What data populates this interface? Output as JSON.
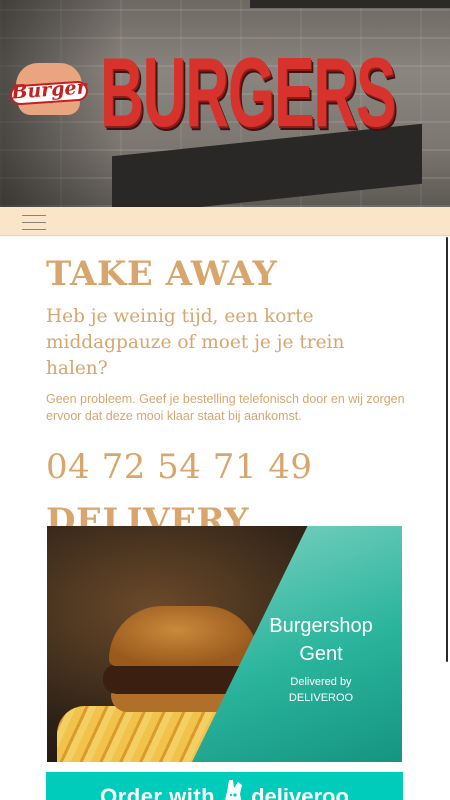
{
  "hero": {
    "sign_text": "BURGERS"
  },
  "logo": {
    "text": "Burger"
  },
  "nav": {
    "menu_icon": "hamburger-menu-icon"
  },
  "takeaway": {
    "heading": "TAKE AWAY",
    "lead": "Heb je weinig tijd, een korte middagpauze of moet je je trein halen?",
    "body": "Geen probleem. Geef je bestelling telefonisch door en wij zorgen ervoor dat deze mooi klaar staat bij aankomst.",
    "phone": "04 72 54 71 49"
  },
  "delivery": {
    "heading": "DELIVERY",
    "promo_title": "Burgershop Gent",
    "promo_delivered_by": "Delivered by",
    "promo_brand": "DELIVEROO"
  },
  "order_button": {
    "prefix": "Order with",
    "brand": "deliveroo",
    "icon": "deliveroo-kangaroo-icon"
  },
  "colors": {
    "accent": "#d8a66d",
    "nav_bg": "#fbe5c9",
    "deliveroo": "#00ccbc",
    "sign_red": "#d8322d"
  }
}
